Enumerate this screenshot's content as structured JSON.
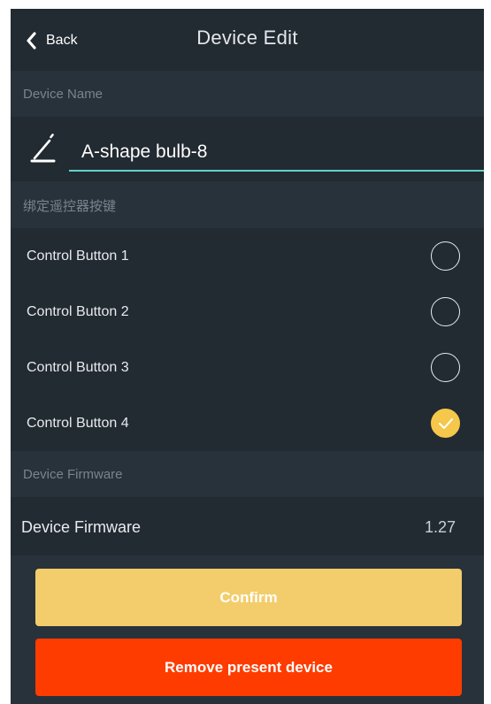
{
  "header": {
    "back_label": "Back",
    "title": "Device Edit",
    "back_icon": "chevron-left-icon"
  },
  "device_name": {
    "section_label": "Device Name",
    "value": "A-shape bulb-8",
    "icon": "pencil-icon",
    "underline_color": "#5fd4c9"
  },
  "bind_buttons": {
    "section_label": "绑定遥控器按键",
    "items": [
      {
        "label": "Control Button 1",
        "checked": false
      },
      {
        "label": "Control Button 2",
        "checked": false
      },
      {
        "label": "Control Button 3",
        "checked": false
      },
      {
        "label": "Control Button 4",
        "checked": true
      }
    ],
    "checked_color": "#f5c74a"
  },
  "firmware": {
    "section_label": "Device Firmware",
    "row_label": "Device Firmware",
    "version": "1.27"
  },
  "actions": {
    "confirm_label": "Confirm",
    "confirm_color": "#f3cd6b",
    "remove_label": "Remove present device",
    "remove_color": "#fe3c00"
  }
}
